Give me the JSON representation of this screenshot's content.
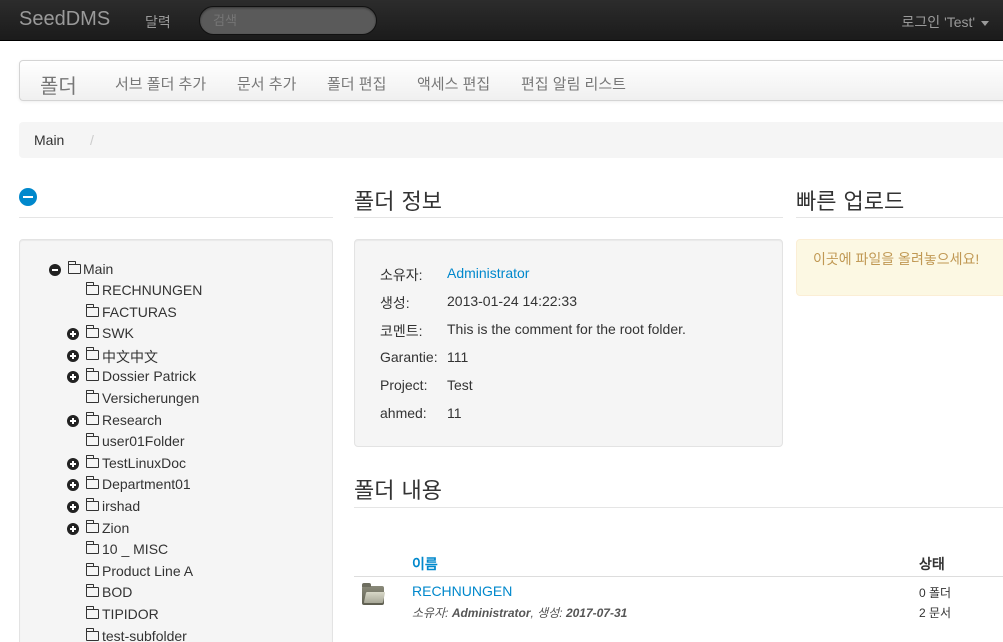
{
  "topbar": {
    "brand": "SeedDMS",
    "calendar": "달력",
    "search_placeholder": "검색",
    "login": "로그인 'Test'"
  },
  "subnav": {
    "title": "폴더",
    "items": [
      "서브 폴더 추가",
      "문서 추가",
      "폴더 편집",
      "액세스 편집",
      "편집 알림 리스트"
    ]
  },
  "breadcrumb": {
    "items": [
      "Main"
    ],
    "divider": "/"
  },
  "tree": {
    "root": "Main",
    "nodes": [
      {
        "label": "RECHNUNGEN",
        "expandable": false
      },
      {
        "label": "FACTURAS",
        "expandable": false
      },
      {
        "label": "SWK",
        "expandable": true
      },
      {
        "label": "中文中文",
        "expandable": true
      },
      {
        "label": "Dossier Patrick",
        "expandable": true
      },
      {
        "label": "Versicherungen",
        "expandable": false
      },
      {
        "label": "Research",
        "expandable": true
      },
      {
        "label": "user01Folder",
        "expandable": false
      },
      {
        "label": "TestLinuxDoc",
        "expandable": true
      },
      {
        "label": "Department01",
        "expandable": true
      },
      {
        "label": "irshad",
        "expandable": true
      },
      {
        "label": "Zion",
        "expandable": true
      },
      {
        "label": "10 _ MISC",
        "expandable": false
      },
      {
        "label": "Product Line A",
        "expandable": false
      },
      {
        "label": "BOD",
        "expandable": false
      },
      {
        "label": "TIPIDOR",
        "expandable": false
      },
      {
        "label": "test-subfolder",
        "expandable": false
      }
    ]
  },
  "folder_info": {
    "heading": "폴더 정보",
    "rows": [
      {
        "key": "소유자:",
        "value": "Administrator"
      },
      {
        "key": "생성:",
        "value": "2013-01-24 14:22:33"
      },
      {
        "key": "코멘트:",
        "value": "This is the comment for the root folder."
      },
      {
        "key": "Garantie:",
        "value": "111"
      },
      {
        "key": "Project:",
        "value": "Test"
      },
      {
        "key": "ahmed:",
        "value": "11"
      }
    ]
  },
  "upload": {
    "heading": "빠른 업로드",
    "hint": "이곳에 파일을 올려놓으세요!"
  },
  "contents": {
    "heading": "폴더 내용",
    "col_name": "이름",
    "col_status": "상태",
    "rows": [
      {
        "name": "RECHNUNGEN",
        "owner_label": "소유자:",
        "owner": "Administrator",
        "created_label": "생성:",
        "created": "2017-07-31",
        "folders": "0 폴더",
        "documents": "2 문서"
      }
    ]
  },
  "colors": {
    "link": "#0088cc",
    "navbar": "#1b1b1b",
    "upload_text": "#c09853"
  }
}
